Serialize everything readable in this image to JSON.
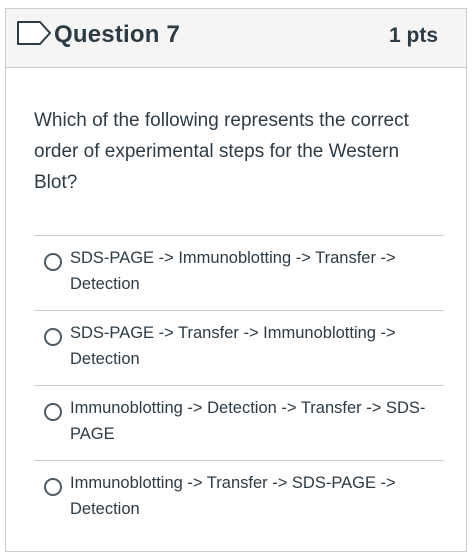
{
  "question": {
    "title": "Question 7",
    "points": "1 pts",
    "text": "Which of the following represents the correct order of experimental steps for the Western Blot?",
    "flag_icon": "bookmark-flag-icon"
  },
  "answers": [
    {
      "label": "SDS-PAGE -> Immunoblotting -> Transfer -> Detection",
      "selected": false
    },
    {
      "label": "SDS-PAGE -> Transfer -> Immunoblotting -> Detection",
      "selected": false
    },
    {
      "label": "Immunoblotting -> Detection -> Transfer -> SDS-PAGE",
      "selected": false
    },
    {
      "label": "Immunoblotting -> Transfer -> SDS-PAGE -> Detection",
      "selected": false
    }
  ],
  "colors": {
    "text": "#2d3b45",
    "border": "#c7cdd1",
    "header_bg": "#f5f5f5"
  }
}
